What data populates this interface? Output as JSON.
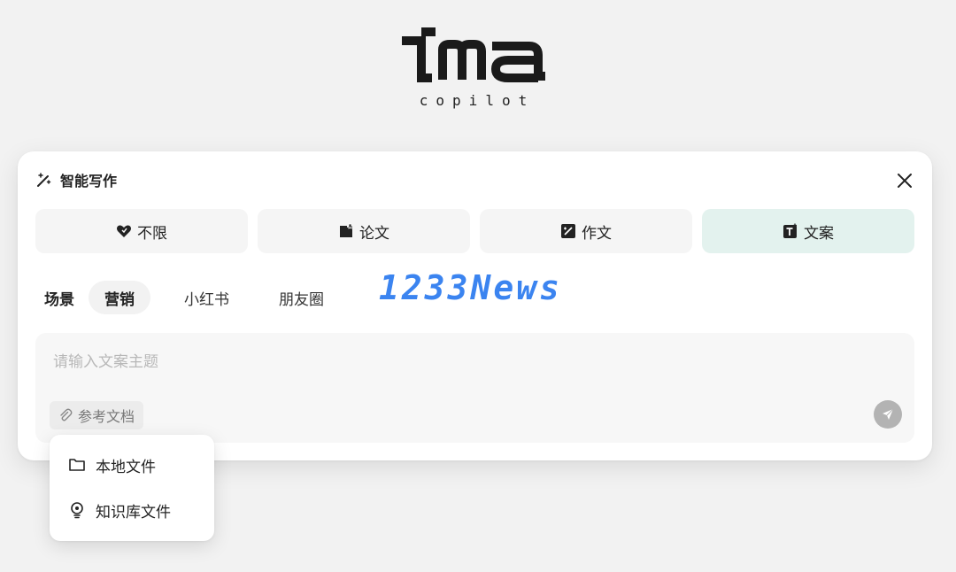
{
  "logo": {
    "wordmark": "ima",
    "subtitle": "copilot"
  },
  "card": {
    "title": "智能写作",
    "modes": [
      {
        "label": "不限",
        "icon": "heart-icon",
        "active": false
      },
      {
        "label": "论文",
        "icon": "paper-icon",
        "active": false
      },
      {
        "label": "作文",
        "icon": "pen-icon",
        "active": false
      },
      {
        "label": "文案",
        "icon": "text-icon",
        "active": true
      }
    ],
    "scene_label": "场景",
    "scenes": [
      {
        "label": "营销",
        "active": true
      },
      {
        "label": "小红书",
        "active": false
      },
      {
        "label": "朋友圈",
        "active": false
      }
    ],
    "input": {
      "placeholder": "请输入文案主题",
      "value": ""
    },
    "reference_label": "参考文档"
  },
  "watermark": "1233News",
  "dropdown": {
    "items": [
      {
        "label": "本地文件",
        "icon": "folder-icon"
      },
      {
        "label": "知识库文件",
        "icon": "bulb-icon"
      }
    ]
  },
  "colors": {
    "active_mode_bg": "#e3f2ee",
    "send_button": "#b3b3b3",
    "watermark": "#3b84f0"
  }
}
